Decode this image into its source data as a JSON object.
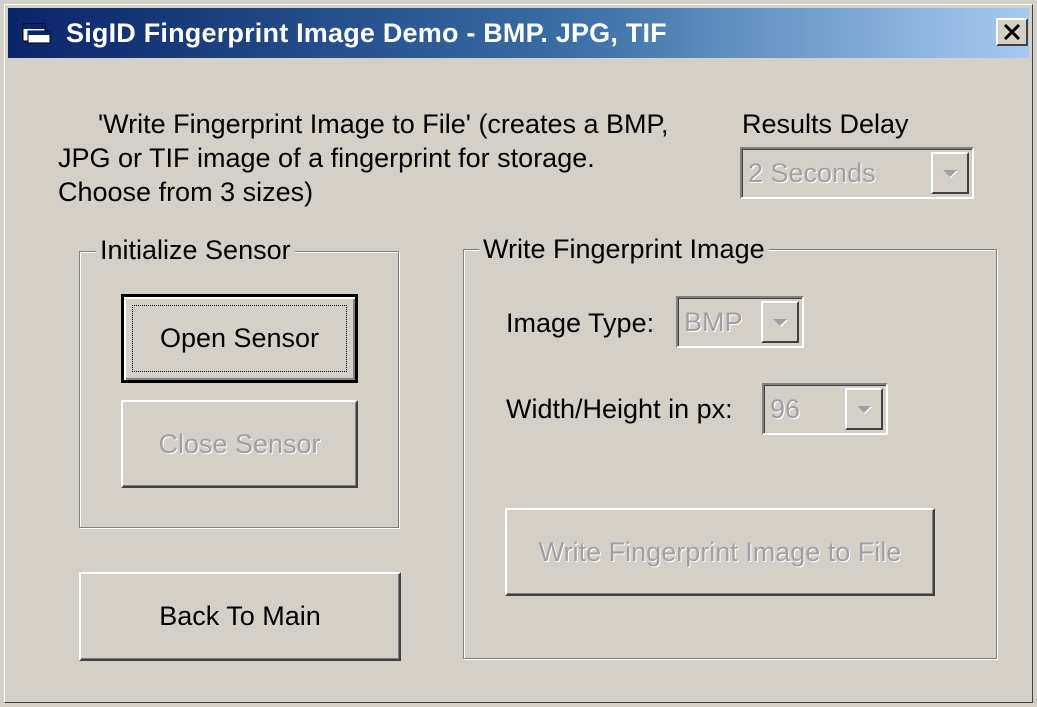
{
  "window": {
    "title": "SigID Fingerprint Image Demo - BMP. JPG, TIF",
    "close_symbol": "✕"
  },
  "description": {
    "line1": "'Write Fingerprint Image to File' (creates a BMP,",
    "line2": "JPG or TIF image of a fingerprint for storage.",
    "line3": "Choose from 3 sizes)"
  },
  "results_delay": {
    "label": "Results Delay",
    "value": "2 Seconds"
  },
  "initialize_sensor": {
    "legend": "Initialize Sensor",
    "open_label": "Open Sensor",
    "close_label": "Close Sensor"
  },
  "back_label": "Back To Main",
  "write_image": {
    "legend": "Write Fingerprint Image",
    "image_type_label": "Image Type:",
    "image_type_value": "BMP",
    "size_label": "Width/Height in px:",
    "size_value": "96",
    "write_label": "Write Fingerprint Image to File"
  },
  "colors": {
    "face": "#d4d0c8",
    "title_start": "#0a246a",
    "title_end": "#a6caf0",
    "disabled_text": "#a0a0a0"
  },
  "icons": {
    "app": "app-window-icon",
    "close": "close-icon",
    "dropdown": "chevron-down-icon"
  }
}
